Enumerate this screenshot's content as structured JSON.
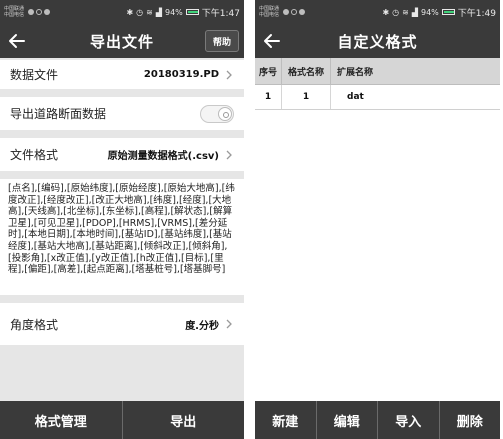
{
  "status_bar_left": {
    "carrier_line1": "中国联通",
    "carrier_line2": "中国电信",
    "battery": "94%",
    "time": "下午1:47"
  },
  "status_bar_right": {
    "carrier_line1": "中国联通",
    "carrier_line2": "中国电信",
    "battery": "94%",
    "time": "下午1:49"
  },
  "export_screen": {
    "title": "导出文件",
    "help_label": "帮助",
    "data_file_label": "数据文件",
    "data_file_value": "20180319.PD",
    "road_section_label": "导出道路断面数据",
    "road_section_enabled": false,
    "file_format_label": "文件格式",
    "file_format_value": "原始测量数据格式(.csv)",
    "fields_text": "[点名],[编码],[原始纬度],[原始经度],[原始大地高],[纬度改正],[经度改正],[改正大地高],[纬度],[经度],[大地高],[天线高],[北坐标],[东坐标],[高程],[解状态],[解算卫星],[可见卫星],[PDOP],[HRMS],[VRMS],[差分延时],[本地日期],[本地时间],[基站ID],[基站纬度],[基站经度],[基站大地高],[基站距离],[倾斜改正],[倾斜角],[投影角],[x改正值],[y改正值],[h改正值],[目标],[里程],[偏距],[高差],[起点距离],[塔基桩号],[塔基脚号]",
    "angle_format_label": "角度格式",
    "angle_format_value": "度.分秒",
    "bottom_buttons": [
      "格式管理",
      "导出"
    ]
  },
  "custom_format_screen": {
    "title": "自定义格式",
    "columns": [
      "序号",
      "格式名称",
      "扩展名称"
    ],
    "rows": [
      {
        "index": "1",
        "format_name": "1",
        "extension": "dat"
      }
    ],
    "bottom_buttons": [
      "新建",
      "编辑",
      "导入",
      "删除"
    ]
  },
  "colors": {
    "bar_dark": "#3a3a3a",
    "page_gray": "#e6e6e6",
    "header_gray": "#d6d6d6",
    "battery_green": "#3fd27a"
  }
}
